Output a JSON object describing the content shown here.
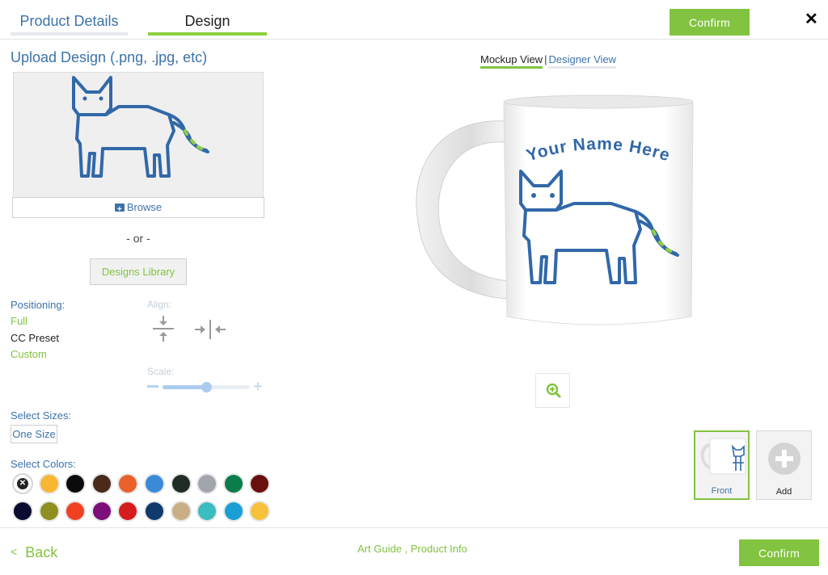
{
  "header": {
    "tabs": [
      {
        "label": "Product Details"
      },
      {
        "label": "Design"
      }
    ],
    "confirm_label": "Confirm",
    "close_glyph": "✕"
  },
  "upload": {
    "title": "Upload Design (.png, .jpg, etc)",
    "browse_label": "Browse",
    "or_text": "- or -",
    "library_label": "Designs Library"
  },
  "positioning": {
    "label": "Positioning:",
    "options": [
      "Full",
      "CC Preset",
      "Custom"
    ],
    "selected": "CC Preset",
    "align_label": "Align:",
    "scale_label": "Scale:",
    "scale_value": 0.5
  },
  "sizes": {
    "label": "Select Sizes:",
    "options": [
      "One Size"
    ]
  },
  "colors": {
    "label": "Select Colors:",
    "swatches": [
      "none",
      "#f7b733",
      "#0b0b0b",
      "#4a2a1a",
      "#e8622a",
      "#3a8ad8",
      "#1f2d24",
      "#a3a5ac",
      "#0b7d4a",
      "#6a0f0f",
      "#0b0a30",
      "#8e8f1e",
      "#f04123",
      "#7c0f7a",
      "#d51d1d",
      "#103a6e",
      "#c9ae85",
      "#39bdbf",
      "#1a9fd4",
      "#f7c13b"
    ]
  },
  "view": {
    "mockup_label": "Mockup View",
    "separator": "|",
    "designer_label": "Designer View"
  },
  "mockup": {
    "text": "Your Name Here",
    "design_color": "#3168a8",
    "accent_color": "#8cd03f"
  },
  "thumbnails": [
    {
      "label": "Front"
    },
    {
      "label": "Add"
    }
  ],
  "footer": {
    "back_glyph": "<",
    "back_label": "Back",
    "links_text": "Art Guide , Product Info",
    "confirm_label": "Confirm"
  }
}
